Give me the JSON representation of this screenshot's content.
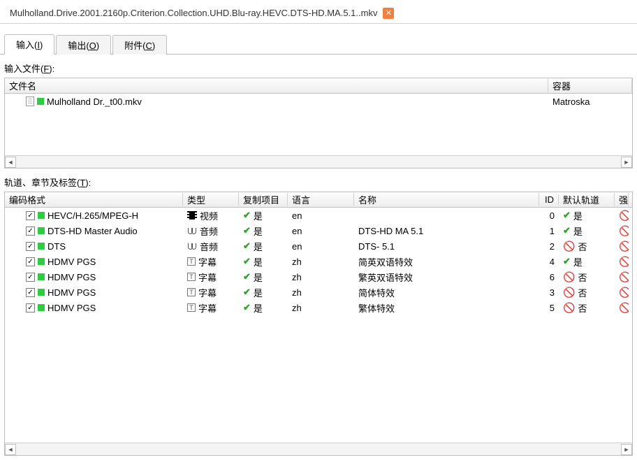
{
  "fileTab": {
    "title": "Mulholland.Drive.2001.2160p.Criterion.Collection.UHD.Blu-ray.HEVC.DTS-HD.MA.5.1..mkv"
  },
  "tabs": {
    "input": {
      "label": "输入(",
      "accel": "I",
      "tail": ")"
    },
    "output": {
      "label": "输出(",
      "accel": "O",
      "tail": ")"
    },
    "attach": {
      "label": "附件(",
      "accel": "C",
      "tail": ")"
    }
  },
  "labels": {
    "inputFiles": {
      "label": "输入文件(",
      "accel": "F",
      "tail": "):"
    },
    "tracks": {
      "label": "轨道、章节及标签(",
      "accel": "T",
      "tail": "):"
    }
  },
  "filesHeader": {
    "name": "文件名",
    "container": "容器"
  },
  "files": [
    {
      "name": "Mulholland Dr._t00.mkv",
      "container": "Matroska"
    }
  ],
  "tracksHeader": {
    "codec": "编码格式",
    "type": "类型",
    "copy": "复制项目",
    "lang": "语言",
    "name": "名称",
    "id": "ID",
    "default": "默认轨道",
    "forced": "强"
  },
  "yes": "是",
  "no": "否",
  "tracks": [
    {
      "checked": true,
      "codec": "HEVC/H.265/MPEG-H",
      "typeIcon": "video",
      "type": "视频",
      "copy": "yes",
      "lang": "en",
      "name": "",
      "id": 0,
      "default": "yes"
    },
    {
      "checked": true,
      "codec": "DTS-HD Master Audio",
      "typeIcon": "audio",
      "type": "音频",
      "copy": "yes",
      "lang": "en",
      "name": "DTS-HD MA 5.1",
      "id": 1,
      "default": "yes"
    },
    {
      "checked": true,
      "codec": "DTS",
      "typeIcon": "audio",
      "type": "音频",
      "copy": "yes",
      "lang": "en",
      "name": "DTS- 5.1",
      "id": 2,
      "default": "no"
    },
    {
      "checked": true,
      "codec": "HDMV PGS",
      "typeIcon": "text",
      "type": "字幕",
      "copy": "yes",
      "lang": "zh",
      "name": "简英双语特效",
      "id": 4,
      "default": "yes"
    },
    {
      "checked": true,
      "codec": "HDMV PGS",
      "typeIcon": "text",
      "type": "字幕",
      "copy": "yes",
      "lang": "zh",
      "name": "繁英双语特效",
      "id": 6,
      "default": "no"
    },
    {
      "checked": true,
      "codec": "HDMV PGS",
      "typeIcon": "text",
      "type": "字幕",
      "copy": "yes",
      "lang": "zh",
      "name": "简体特效",
      "id": 3,
      "default": "no"
    },
    {
      "checked": true,
      "codec": "HDMV PGS",
      "typeIcon": "text",
      "type": "字幕",
      "copy": "yes",
      "lang": "zh",
      "name": "繁体特效",
      "id": 5,
      "default": "no"
    }
  ]
}
